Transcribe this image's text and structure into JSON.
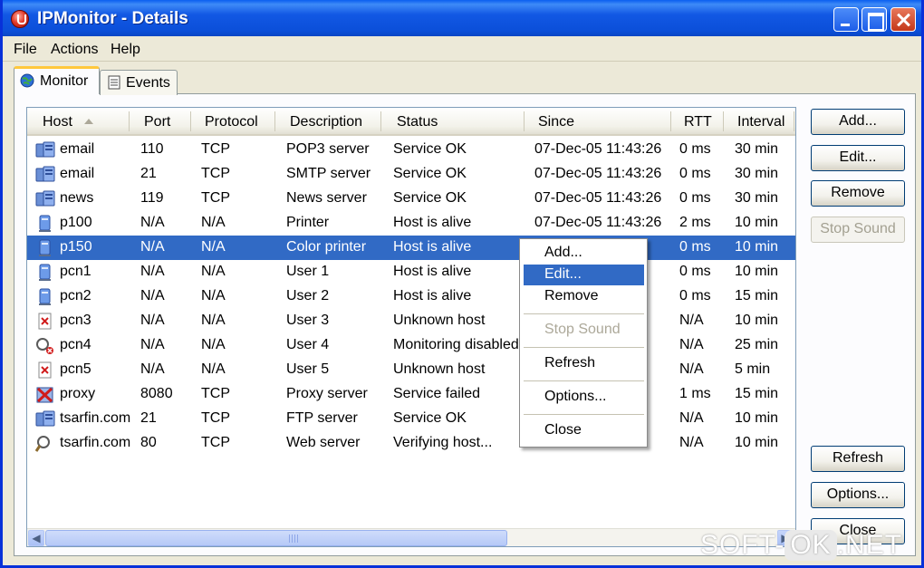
{
  "window": {
    "title": "IPMonitor - Details"
  },
  "menubar": {
    "items": [
      "File",
      "Actions",
      "Help"
    ]
  },
  "tabs": [
    {
      "label": "Monitor",
      "icon": "globe-monitor-icon",
      "active": true
    },
    {
      "label": "Events",
      "icon": "document-icon",
      "active": false
    }
  ],
  "columns": {
    "host": "Host",
    "port": "Port",
    "protocol": "Protocol",
    "description": "Description",
    "status": "Status",
    "since": "Since",
    "rtt": "RTT",
    "interval": "Interval"
  },
  "rows": [
    {
      "icon": "service-ok-icon",
      "host": "email",
      "port": "110",
      "protocol": "TCP",
      "description": "POP3 server",
      "status": "Service OK",
      "since": "07-Dec-05 11:43:26",
      "rtt": "0 ms",
      "interval": "30 min"
    },
    {
      "icon": "service-ok-icon",
      "host": "email",
      "port": "21",
      "protocol": "TCP",
      "description": "SMTP server",
      "status": "Service OK",
      "since": "07-Dec-05 11:43:26",
      "rtt": "0 ms",
      "interval": "30 min"
    },
    {
      "icon": "service-ok-icon",
      "host": "news",
      "port": "119",
      "protocol": "TCP",
      "description": "News server",
      "status": "Service OK",
      "since": "07-Dec-05 11:43:26",
      "rtt": "0 ms",
      "interval": "30 min"
    },
    {
      "icon": "host-alive-icon",
      "host": "p100",
      "port": "N/A",
      "protocol": "N/A",
      "description": "Printer",
      "status": "Host is alive",
      "since": "07-Dec-05 11:43:26",
      "rtt": "2 ms",
      "interval": "10 min"
    },
    {
      "icon": "host-alive-icon",
      "host": "p150",
      "port": "N/A",
      "protocol": "N/A",
      "description": "Color printer",
      "status": "Host is alive",
      "since": "6",
      "rtt": "0 ms",
      "interval": "10 min",
      "selected": true
    },
    {
      "icon": "host-alive-icon",
      "host": "pcn1",
      "port": "N/A",
      "protocol": "N/A",
      "description": "User 1",
      "status": "Host is alive",
      "since": "6",
      "rtt": "0 ms",
      "interval": "10 min"
    },
    {
      "icon": "host-alive-icon",
      "host": "pcn2",
      "port": "N/A",
      "protocol": "N/A",
      "description": "User 2",
      "status": "Host is alive",
      "since": "6",
      "rtt": "0 ms",
      "interval": "15 min"
    },
    {
      "icon": "unknown-host-icon",
      "host": "pcn3",
      "port": "N/A",
      "protocol": "N/A",
      "description": "User 3",
      "status": "Unknown host",
      "since": "8",
      "rtt": "N/A",
      "interval": "10 min"
    },
    {
      "icon": "monitoring-disabled-icon",
      "host": "pcn4",
      "port": "N/A",
      "protocol": "N/A",
      "description": "User 4",
      "status": "Monitoring disabled",
      "since": "6",
      "rtt": "N/A",
      "interval": "25 min"
    },
    {
      "icon": "unknown-host-icon",
      "host": "pcn5",
      "port": "N/A",
      "protocol": "N/A",
      "description": "User 5",
      "status": "Unknown host",
      "since": "8",
      "rtt": "N/A",
      "interval": "5 min"
    },
    {
      "icon": "service-failed-icon",
      "host": "proxy",
      "port": "8080",
      "protocol": "TCP",
      "description": "Proxy server",
      "status": "Service failed",
      "since": "7",
      "rtt": "1 ms",
      "interval": "15 min"
    },
    {
      "icon": "service-ok-icon",
      "host": "tsarfin.com",
      "port": "21",
      "protocol": "TCP",
      "description": "FTP server",
      "status": "Service OK",
      "since": "6",
      "rtt": "N/A",
      "interval": "10 min"
    },
    {
      "icon": "verifying-host-icon",
      "host": "tsarfin.com",
      "port": "80",
      "protocol": "TCP",
      "description": "Web server",
      "status": "Verifying host...",
      "since": "2",
      "rtt": "N/A",
      "interval": "10 min"
    }
  ],
  "buttons": {
    "add": "Add...",
    "edit": "Edit...",
    "remove": "Remove",
    "stop_sound": "Stop Sound",
    "refresh": "Refresh",
    "options": "Options...",
    "close": "Close"
  },
  "context_menu": {
    "add": "Add...",
    "edit": "Edit...",
    "remove": "Remove",
    "stop_sound": "Stop Sound",
    "refresh": "Refresh",
    "options": "Options...",
    "close": "Close"
  },
  "watermark": {
    "left": "SOFT-",
    "ok": "OK",
    "right": ".NET"
  },
  "colors": {
    "selection": "#316ac5",
    "titlebar": "#0b4fd9",
    "face": "#ece9d8"
  }
}
